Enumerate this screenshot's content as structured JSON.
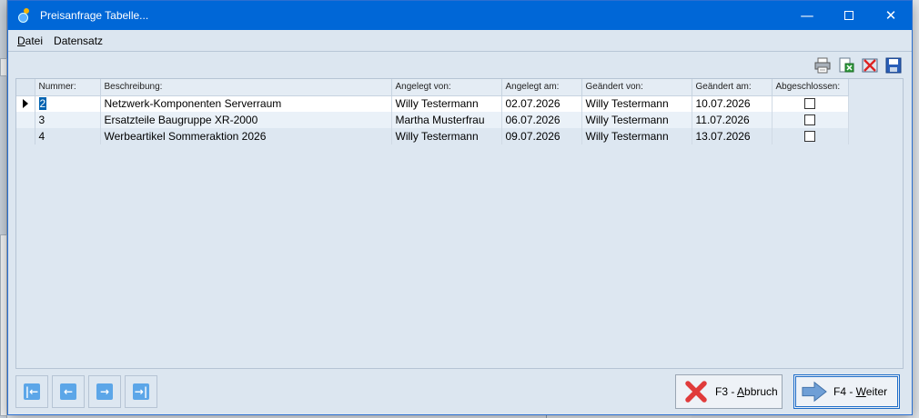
{
  "window": {
    "title": "Preisanfrage Tabelle...",
    "minimize_glyph": "—",
    "close_glyph": "✕"
  },
  "menu": [
    {
      "label": "Datei",
      "mnemonic": "D",
      "rest": "atei"
    },
    {
      "label": "Datensatz",
      "mnemonic": "",
      "rest": "Datensatz"
    }
  ],
  "toolbar": {
    "icons": [
      "printer-icon",
      "export-icon",
      "delete-icon",
      "save-icon"
    ]
  },
  "table": {
    "columns": [
      "Nummer:",
      "Beschreibung:",
      "Angelegt von:",
      "Angelegt am:",
      "Geändert von:",
      "Geändert am:",
      "Abgeschlossen:"
    ],
    "rows": [
      {
        "nummer": "2",
        "beschreibung": "Netzwerk-Komponenten Serverraum",
        "angelegt_von": "Willy Testermann",
        "angelegt_am": "02.07.2026",
        "geaendert_von": "Willy Testermann",
        "geaendert_am": "10.07.2026",
        "abgeschlossen": false
      },
      {
        "nummer": "3",
        "beschreibung": "Ersatzteile Baugruppe XR-2000",
        "angelegt_von": "Martha Musterfrau",
        "angelegt_am": "06.07.2026",
        "geaendert_von": "Willy Testermann",
        "geaendert_am": "11.07.2026",
        "abgeschlossen": false
      },
      {
        "nummer": "4",
        "beschreibung": "Werbeartikel Sommeraktion 2026",
        "angelegt_von": "Willy Testermann",
        "angelegt_am": "09.07.2026",
        "geaendert_von": "Willy Testermann",
        "geaendert_am": "13.07.2026",
        "abgeschlossen": false
      }
    ]
  },
  "navigation": {
    "buttons": [
      {
        "name": "first-record",
        "glyph": "|←"
      },
      {
        "name": "previous-record",
        "glyph": "←"
      },
      {
        "name": "next-record",
        "glyph": "→"
      },
      {
        "name": "last-record",
        "glyph": "→|"
      }
    ]
  },
  "actions": {
    "abbruch": {
      "prefix": "F3 - ",
      "mnemonic": "A",
      "rest": "bbruch"
    },
    "weiter": {
      "prefix": "F4 - ",
      "mnemonic": "W",
      "rest": "eiter"
    }
  },
  "colors": {
    "titlebar": "#0067d7",
    "selection": "#0063b1",
    "window_bg": "#dce6f0"
  }
}
